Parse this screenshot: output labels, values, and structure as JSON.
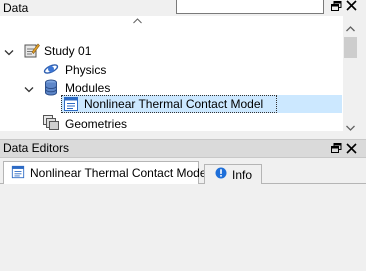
{
  "data_panel": {
    "title": "Data",
    "search_value": "",
    "float_icon": "restore-window-icon",
    "close_icon": "close-icon"
  },
  "tree": {
    "items": [
      {
        "label": "Study 01",
        "icon": "study-icon"
      },
      {
        "label": "Physics",
        "icon": "physics-icon"
      },
      {
        "label": "Modules",
        "icon": "database-icon"
      },
      {
        "label": "Nonlinear Thermal Contact Model",
        "icon": "document-icon",
        "selected": true
      },
      {
        "label": "Geometries",
        "icon": "geometries-icon"
      }
    ]
  },
  "data_editors": {
    "title": "Data Editors",
    "tabs": [
      {
        "label": "Nonlinear Thermal Contact Model",
        "icon": "document-icon",
        "active": true
      },
      {
        "label": "Info",
        "icon": "info-icon",
        "active": false
      }
    ]
  },
  "colors": {
    "selection": "#cce8ff",
    "header_bg": "#dadada",
    "info_blue": "#1e6fd9"
  }
}
